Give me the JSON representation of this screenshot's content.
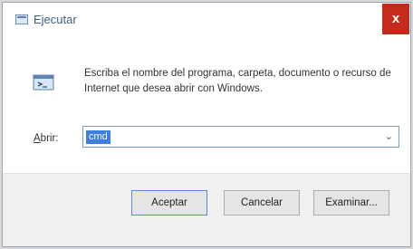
{
  "window": {
    "title": "Ejecutar",
    "close_glyph": "x"
  },
  "content": {
    "message": "Escriba el nombre del programa, carpeta, documento o recurso de Internet que desea abrir con Windows.",
    "open_label": "Abrir:",
    "open_value": "cmd",
    "dropdown_glyph": "⌄"
  },
  "buttons": {
    "ok": "Aceptar",
    "cancel": "Cancelar",
    "browse": "Examinar..."
  }
}
